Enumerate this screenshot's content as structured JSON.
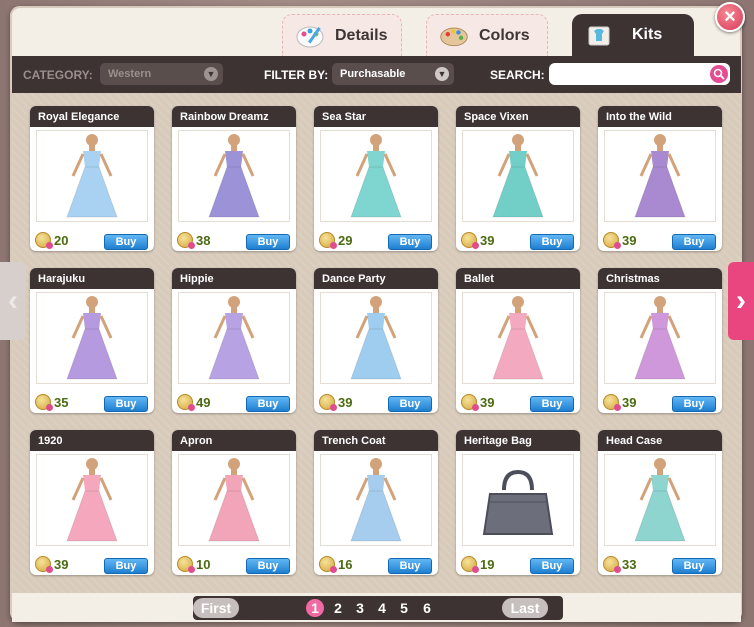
{
  "tabs": [
    {
      "label": "Details",
      "icon": "palette-brush-icon",
      "active": false
    },
    {
      "label": "Colors",
      "icon": "color-palette-icon",
      "active": false
    },
    {
      "label": "Kits",
      "icon": "kit-shirt-icon",
      "active": true
    }
  ],
  "close_label": "×",
  "filterbar": {
    "category_label": "CATEGORY:",
    "category_value": "Western",
    "filter_label": "FILTER BY:",
    "filter_value": "Purchasable",
    "search_label": "SEARCH:",
    "search_value": ""
  },
  "items": [
    {
      "name": "Royal Elegance",
      "price": "20",
      "buy": "Buy",
      "color": "#a9d2f2"
    },
    {
      "name": "Rainbow Dreamz",
      "price": "38",
      "buy": "Buy",
      "color": "#9c92d8"
    },
    {
      "name": "Sea Star",
      "price": "29",
      "buy": "Buy",
      "color": "#7fd5cf"
    },
    {
      "name": "Space Vixen",
      "price": "39",
      "buy": "Buy",
      "color": "#72cfc8"
    },
    {
      "name": "Into the Wild",
      "price": "39",
      "buy": "Buy",
      "color": "#a98ad1"
    },
    {
      "name": "Harajuku",
      "price": "35",
      "buy": "Buy",
      "color": "#b69ae0"
    },
    {
      "name": "Hippie",
      "price": "49",
      "buy": "Buy",
      "color": "#b7a2e3"
    },
    {
      "name": "Dance Party",
      "price": "39",
      "buy": "Buy",
      "color": "#9fcdf0"
    },
    {
      "name": "Ballet",
      "price": "39",
      "buy": "Buy",
      "color": "#f3aac0"
    },
    {
      "name": "Christmas",
      "price": "39",
      "buy": "Buy",
      "color": "#cf98db"
    },
    {
      "name": "1920",
      "price": "39",
      "buy": "Buy",
      "color": "#f5a8bd"
    },
    {
      "name": "Apron",
      "price": "10",
      "buy": "Buy",
      "color": "#f2a5b8"
    },
    {
      "name": "Trench Coat",
      "price": "16",
      "buy": "Buy",
      "color": "#a7cdee"
    },
    {
      "name": "Heritage Bag",
      "price": "19",
      "buy": "Buy",
      "color": "#6c6e7c"
    },
    {
      "name": "Head Case",
      "price": "33",
      "buy": "Buy",
      "color": "#8ed4cf"
    }
  ],
  "pager": {
    "first": "First",
    "last": "Last",
    "pages": [
      "1",
      "2",
      "3",
      "4",
      "5",
      "6"
    ],
    "current": "1"
  },
  "arrows": {
    "left": "‹",
    "right": "›"
  }
}
